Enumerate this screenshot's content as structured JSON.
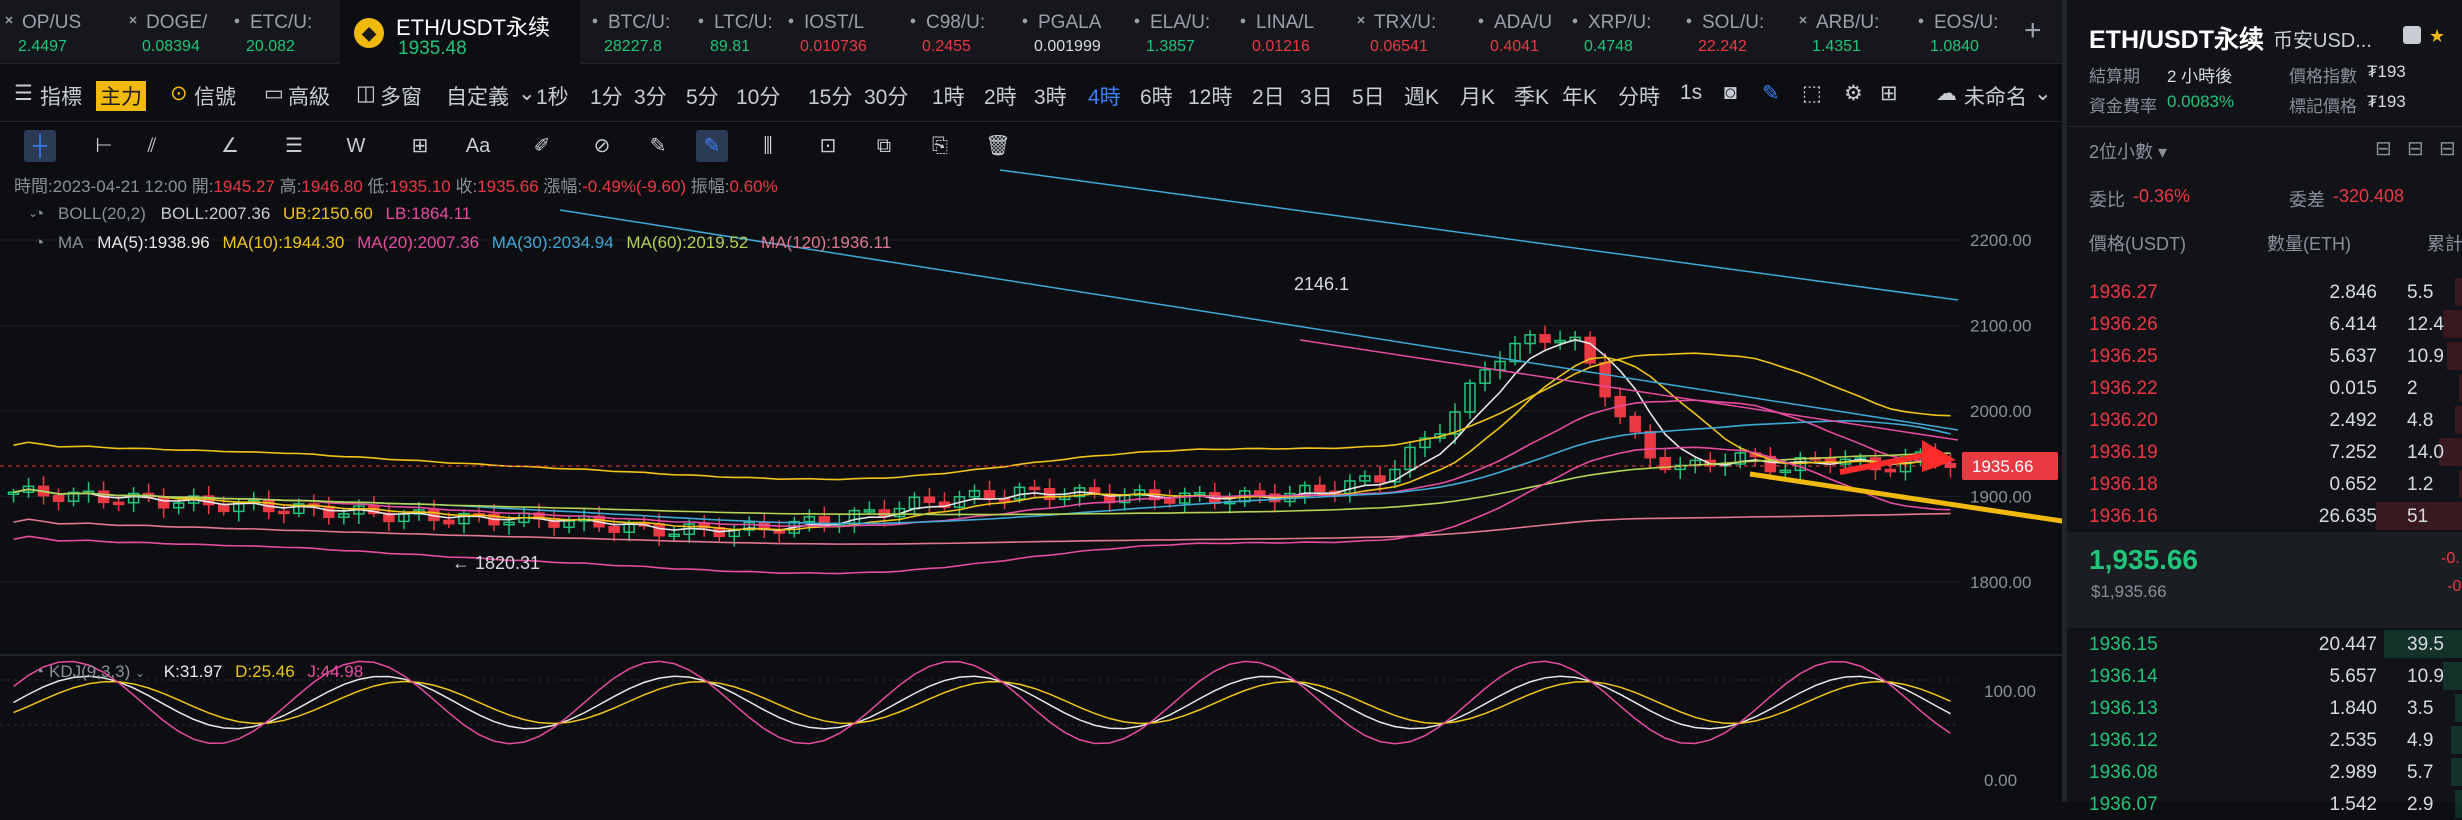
{
  "tabs": [
    {
      "sym": "OP/US",
      "price": "2.4497",
      "dir": "up",
      "icon": "✕"
    },
    {
      "sym": "DOGE/",
      "price": "0.08394",
      "dir": "up",
      "icon": "✕"
    },
    {
      "sym": "ETC/U:",
      "price": "20.082",
      "dir": "up",
      "icon": "●"
    },
    {
      "sym": "ETH/USDT永续",
      "price": "1935.48",
      "dir": "up",
      "icon": "◆",
      "active": true
    },
    {
      "sym": "BTC/U:",
      "price": "28227.8",
      "dir": "up",
      "icon": "●"
    },
    {
      "sym": "LTC/U:",
      "price": "89.81",
      "dir": "up",
      "icon": "●"
    },
    {
      "sym": "IOST/L",
      "price": "0.010736",
      "dir": "dn",
      "icon": "●"
    },
    {
      "sym": "C98/U:",
      "price": "0.2455",
      "dir": "dn",
      "icon": "●"
    },
    {
      "sym": "PGALA",
      "price": "0.001999",
      "dir": "flat",
      "icon": "●"
    },
    {
      "sym": "ELA/U:",
      "price": "1.3857",
      "dir": "up",
      "icon": "●"
    },
    {
      "sym": "LINA/L",
      "price": "0.01216",
      "dir": "dn",
      "icon": "●"
    },
    {
      "sym": "TRX/U:",
      "price": "0.06541",
      "dir": "dn",
      "icon": "✕"
    },
    {
      "sym": "ADA/U",
      "price": "0.4041",
      "dir": "dn",
      "icon": "●"
    },
    {
      "sym": "XRP/U:",
      "price": "0.4748",
      "dir": "up",
      "icon": "●"
    },
    {
      "sym": "SOL/U:",
      "price": "22.242",
      "dir": "dn",
      "icon": "●"
    },
    {
      "sym": "ARB/U:",
      "price": "1.4351",
      "dir": "up",
      "icon": "✕"
    },
    {
      "sym": "EOS/U:",
      "price": "1.0840",
      "dir": "up",
      "icon": "●"
    }
  ],
  "add_tab": "+",
  "toolbar": {
    "indicators": "指標",
    "main": "主力",
    "signal": "信號",
    "advanced": "高級",
    "multi": "多窗",
    "custom": "自定義",
    "seconds": "1秒",
    "intervals": [
      "1分",
      "3分",
      "5分",
      "10分",
      "15分",
      "30分",
      "1時",
      "2時",
      "3時",
      "4時",
      "6時",
      "12時",
      "2日",
      "3日",
      "5日",
      "週K",
      "月K",
      "季K",
      "年K",
      "分時",
      "1s"
    ],
    "active_interval": "4時",
    "unnamed": "未命名"
  },
  "drawing_tools": [
    "crosshair-icon",
    "horizontal-line-icon",
    "trend-line-icon",
    "angle-icon",
    "fib-icon",
    "wave-icon",
    "measure-icon",
    "text-icon",
    "brush-icon",
    "eraser-icon",
    "ruler-icon",
    "pen-icon",
    "pattern-icon",
    "lock-icon",
    "copy-icon",
    "save-icon",
    "trash-icon"
  ],
  "ohlc": {
    "time_label": "時間",
    "time": "2023-04-21 12:00",
    "open_label": "開",
    "open": "1945.27",
    "high_label": "高",
    "high": "1946.80",
    "low_label": "低",
    "low": "1935.10",
    "close_label": "收",
    "close": "1935.66",
    "change_label": "漲幅",
    "change": "-0.49%(-9.60)",
    "amp_label": "振幅",
    "amp": "0.60%"
  },
  "boll": {
    "name": "BOLL(20,2)",
    "boll": "BOLL:2007.36",
    "ub": "UB:2150.60",
    "lb": "LB:1864.11"
  },
  "ma": {
    "name": "MA",
    "ma5": "MA(5):1938.96",
    "ma10": "MA(10):1944.30",
    "ma20": "MA(20):2007.36",
    "ma30": "MA(30):2034.94",
    "ma60": "MA(60):2019.52",
    "ma120": "MA(120):1936.11"
  },
  "kdj": {
    "name": "KDJ(9,3,3)",
    "k": "K:31.97",
    "d": "D:25.46",
    "j": "J:44.98"
  },
  "price_axis": [
    "2200.00",
    "2100.00",
    "2000.00",
    "1900.00",
    "1800.00"
  ],
  "kdj_axis": [
    "100.00",
    "0.00"
  ],
  "high_marker": "2146.1",
  "low_marker": "← 1820.31",
  "current_price": "1935.66",
  "colors": {
    "up": "#21c47a",
    "down": "#ea3943",
    "ma5": "#e8e8e8",
    "ma10": "#f0c419",
    "ma20": "#e64ca0",
    "ma30": "#3fa9d6",
    "ma60": "#b4d455",
    "ma120": "#e07890",
    "accent": "#f0b90b"
  },
  "right": {
    "title": "ETH/USDT永续",
    "exchange": "币安USD...",
    "settle_label": "結算期",
    "settle": "2 小時後",
    "fund_label": "資金費率",
    "fund": "0.0083%",
    "index_label": "價格指數",
    "index": "₮193",
    "mark_label": "標記價格",
    "mark": "₮193",
    "decimals": "2位小數",
    "ratio_label": "委比",
    "ratio": "-0.36%",
    "diff_label": "委差",
    "diff": "-320.408",
    "hdr_price": "價格(USDT)",
    "hdr_qty": "數量(ETH)",
    "hdr_total": "累計",
    "asks": [
      {
        "p": "1936.27",
        "q": "2.846",
        "t": "5.5",
        "w": 0.02
      },
      {
        "p": "1936.26",
        "q": "6.414",
        "t": "12.4",
        "w": 0.05
      },
      {
        "p": "1936.25",
        "q": "5.637",
        "t": "10.9",
        "w": 0.04
      },
      {
        "p": "1936.22",
        "q": "0.015",
        "t": "2",
        "w": 0.01
      },
      {
        "p": "1936.20",
        "q": "2.492",
        "t": "4.8",
        "w": 0.02
      },
      {
        "p": "1936.19",
        "q": "7.252",
        "t": "14.0",
        "w": 0.06
      },
      {
        "p": "1936.18",
        "q": "0.652",
        "t": "1.2",
        "w": 0.01
      },
      {
        "p": "1936.16",
        "q": "26.635",
        "t": "51",
        "w": 0.22
      }
    ],
    "last": "1,935.66",
    "last_sub": "$1,935.66",
    "last_chg": "-0.",
    "last_chg2": "-0",
    "bids": [
      {
        "p": "1936.15",
        "q": "20.447",
        "t": "39.5",
        "w": 0.2
      },
      {
        "p": "1936.14",
        "q": "5.657",
        "t": "10.9",
        "w": 0.05
      },
      {
        "p": "1936.13",
        "q": "1.840",
        "t": "3.5",
        "w": 0.02
      },
      {
        "p": "1936.12",
        "q": "2.535",
        "t": "4.9",
        "w": 0.03
      },
      {
        "p": "1936.08",
        "q": "2.989",
        "t": "5.7",
        "w": 0.03
      },
      {
        "p": "1936.07",
        "q": "1.542",
        "t": "2.9",
        "w": 0.02
      }
    ]
  }
}
